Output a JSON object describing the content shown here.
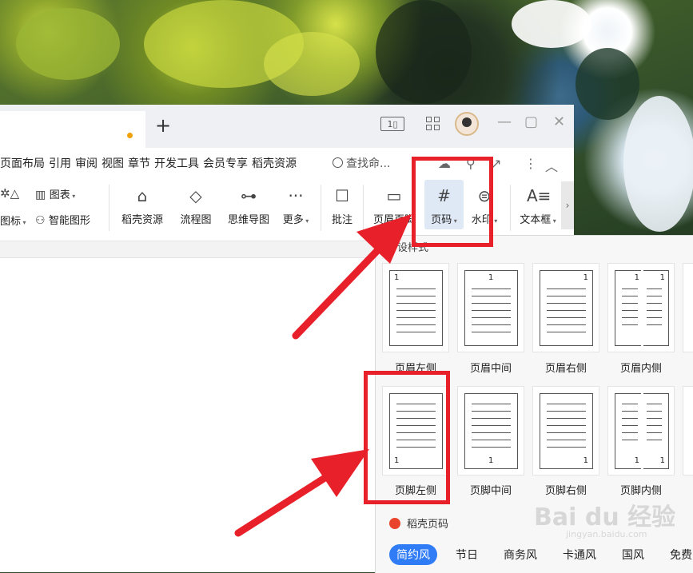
{
  "tabbar": {
    "add_label": "+",
    "layout_icon_text": "1▯",
    "minimize": "—",
    "maximize": "▢",
    "close": "✕"
  },
  "menu": {
    "items": [
      "页面布局",
      "引用",
      "审阅",
      "视图",
      "章节",
      "开发工具",
      "会员专享",
      "稻壳资源"
    ],
    "search_label": "查找命..."
  },
  "ribbon": {
    "icon_label": "图标",
    "chart_label": "图表",
    "smartart_label": "智能图形",
    "daoke_label": "稻壳资源",
    "flowchart_label": "流程图",
    "mindmap_label": "思维导图",
    "more_label": "更多",
    "comment_label": "批注",
    "header_footer_label": "页眉页脚",
    "page_number_label": "页码",
    "watermark_label": "水印",
    "textbox_label": "文本框"
  },
  "panel": {
    "title": "设样式",
    "presets": [
      {
        "label": "页眉左侧",
        "position": "header-left",
        "number": "1"
      },
      {
        "label": "页眉中间",
        "position": "header-center",
        "number": "1"
      },
      {
        "label": "页眉右侧",
        "position": "header-right",
        "number": "1"
      },
      {
        "label": "页眉内侧",
        "position": "header-inside",
        "number": "1"
      },
      {
        "label": "页脚左侧",
        "position": "footer-left",
        "number": "1"
      },
      {
        "label": "页脚中间",
        "position": "footer-center",
        "number": "1"
      },
      {
        "label": "页脚右侧",
        "position": "footer-right",
        "number": "1"
      },
      {
        "label": "页脚内侧",
        "position": "footer-inside",
        "number": "1"
      }
    ],
    "brand_label": "稻壳页码",
    "styles": [
      {
        "label": "简约风",
        "active": true
      },
      {
        "label": "节日",
        "active": false
      },
      {
        "label": "商务风",
        "active": false
      },
      {
        "label": "卡通风",
        "active": false
      },
      {
        "label": "国风",
        "active": false
      },
      {
        "label": "免费",
        "active": false
      }
    ]
  },
  "watermark": {
    "main": "Bai du 经验",
    "sub": "jingyan.baidu.com"
  },
  "colors": {
    "accent": "#2f7cf6",
    "annotation": "#e8202a",
    "tab_dot": "#f0a10a"
  }
}
